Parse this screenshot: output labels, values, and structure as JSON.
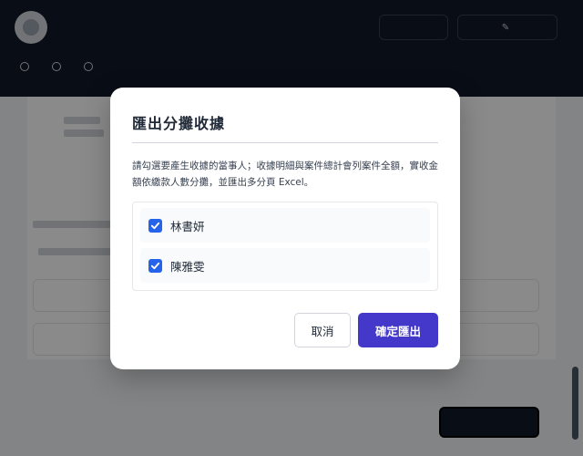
{
  "app": {
    "title": "",
    "header_buttons": [
      "",
      ""
    ],
    "nav": [
      "",
      "",
      ""
    ]
  },
  "modal": {
    "title": "匯出分攤收據",
    "description": "請勾選要產生收據的當事人；收據明細與案件總計會列案件全額，實收金額依繳款人數分攤，並匯出多分頁 Excel。",
    "recipients": [
      {
        "name": "林書妍",
        "checked": true
      },
      {
        "name": "陳雅雯",
        "checked": true
      }
    ],
    "cancel_label": "取消",
    "confirm_label": "確定匯出"
  },
  "colors": {
    "accent": "#4338ca",
    "checkbox": "#2563eb",
    "header_bg": "#111827",
    "overlay": "rgba(0,0,0,0.46)"
  }
}
